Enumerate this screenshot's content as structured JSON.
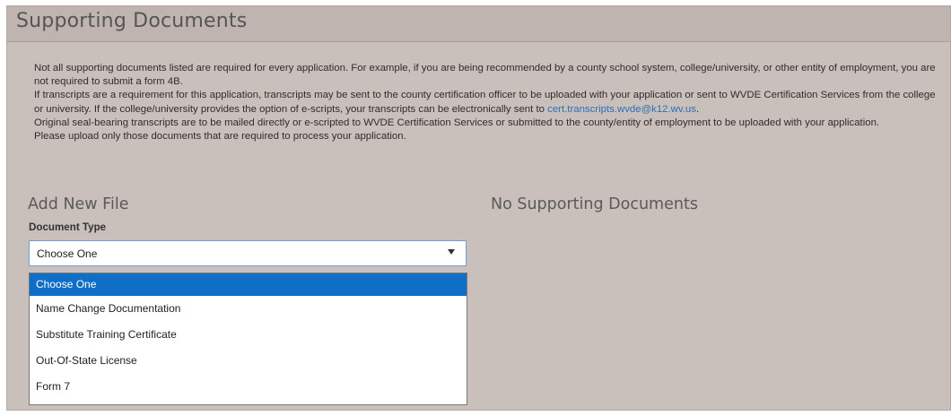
{
  "header": {
    "title": "Supporting Documents"
  },
  "intro": {
    "paragraph1": "Not all supporting documents listed are required for every application. For example, if you are being recommended by a county school system, college/university, or other entity of employment, you are not required to submit a form 4B.",
    "paragraph2_before_link": "If transcripts are a requirement for this application, transcripts may be sent to the county certification officer to be uploaded with your application or sent to WVDE Certification Services from the college or university. If the college/university provides the option of e-scripts, your transcripts can be electronically sent to ",
    "paragraph2_link": "cert.transcripts.wvde@k12.wv.us",
    "paragraph2_after_link": ".",
    "paragraph3": "Original seal-bearing transcripts are to be mailed directly or e-scripted to WVDE Certification Services or submitted to the county/entity of employment to be uploaded with your application.",
    "paragraph4": "Please upload only those documents that are required to process your application."
  },
  "add_file": {
    "heading": "Add New File",
    "document_type_label": "Document Type",
    "select_value": "Choose One",
    "options": [
      "Choose One",
      "Name Change Documentation",
      "Substitute Training Certificate",
      "Out-Of-State License",
      "Form 7"
    ]
  },
  "documents": {
    "empty_message": "No Supporting Documents"
  },
  "colors": {
    "panel_background": "#c9bfbb",
    "header_background": "#bfb4b0",
    "link": "#2f6fb4",
    "selected_option": "#0f6ec6",
    "select_border": "#6fa0d4"
  },
  "icons": {
    "select_arrow": "chevron-down-icon"
  }
}
